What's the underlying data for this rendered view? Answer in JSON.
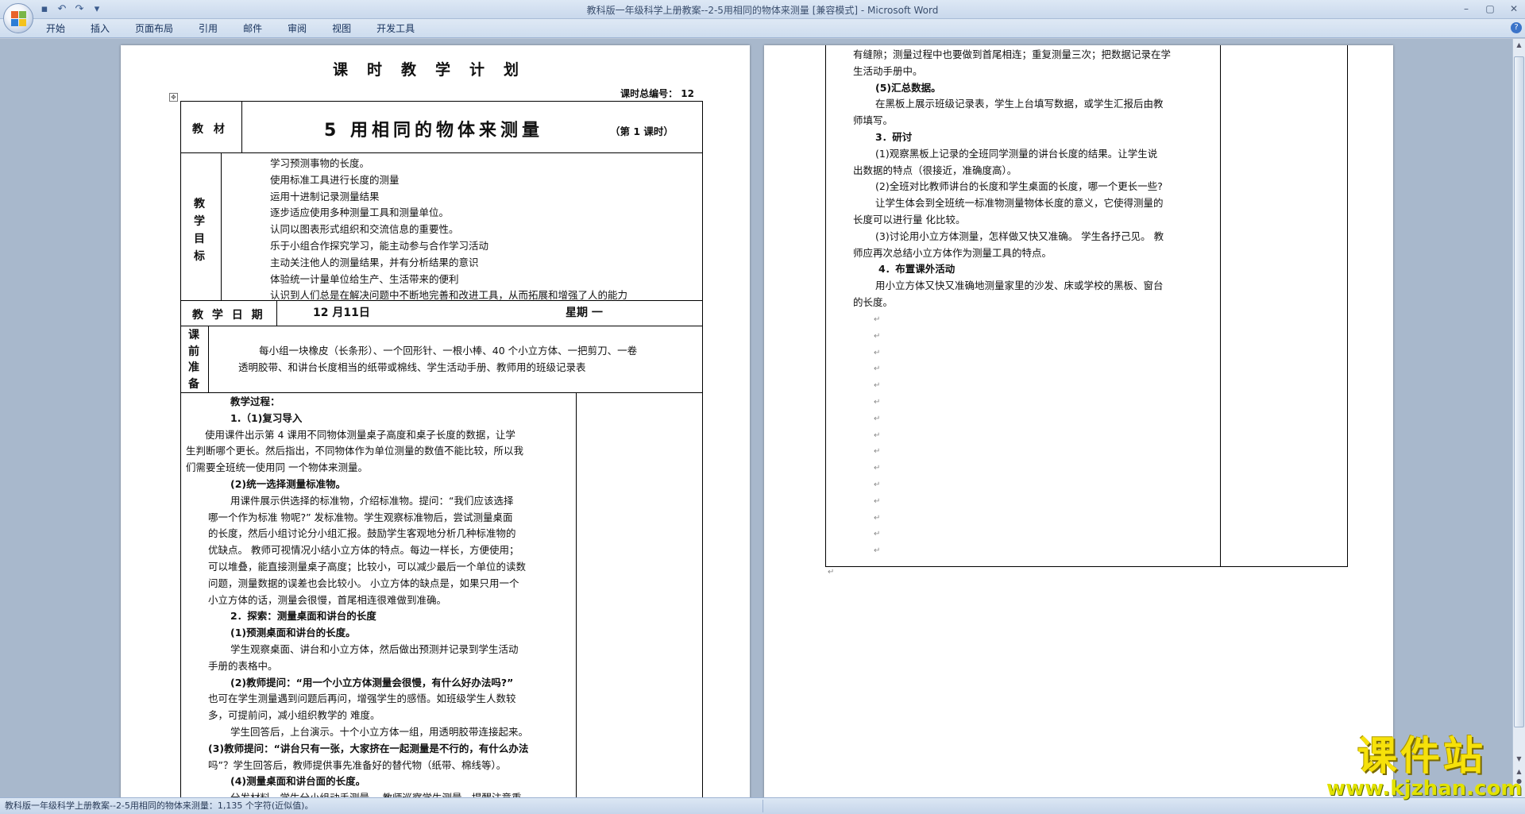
{
  "window": {
    "title": "教科版一年级科学上册教案--2-5用相同的物体来测量 [兼容模式] - Microsoft Word",
    "controls": [
      "–",
      "▢",
      "✕"
    ]
  },
  "quick_access": [
    "save-icon",
    "undo-icon",
    "redo-icon",
    "customize-icon"
  ],
  "ribbon": {
    "tabs": [
      "开始",
      "插入",
      "页面布局",
      "引用",
      "邮件",
      "审阅",
      "视图",
      "开发工具"
    ]
  },
  "page1": {
    "title": "课时教学计划",
    "seq_label": "课时总编号：",
    "seq_value": "12",
    "material_label": "教  材",
    "lesson_title": "5 用相同的物体来测量",
    "lesson_period": "（第 1 课时）",
    "goals_label": [
      "教",
      "学",
      "目",
      "标"
    ],
    "goals": [
      "学习预测事物的长度。",
      " 使用标准工具进行长度的测量",
      "运用十进制记录测量结果",
      "逐步适应使用多种测量工具和测量单位。",
      "认同以图表形式组织和交流信息的重要性。",
      "乐于小组合作探究学习，能主动参与合作学习活动",
      "主动关注他人的测量结果，并有分析结果的意识",
      "体验统一计量单位给生产、生活带来的便利",
      "认识到人们总是在解决问题中不断地完善和改进工具，从而拓展和增强了人的能力"
    ],
    "date_label": "教 学 日 期",
    "date_value": "12   月11日",
    "weekday": "星期 一",
    "prep_label": [
      "课",
      "前",
      "准",
      "备"
    ],
    "prep_lines": [
      "每小组一块橡皮（长条形）、一个回形针、一根小棒、40 个小立方体、一把剪刀、一卷",
      "透明胶带、和讲台长度相当的纸带或棉线、学生活动手册、教师用的班级记录表"
    ],
    "process": [
      {
        "text": "教学过程：",
        "bold": true,
        "indent": 62
      },
      {
        "text": "1.（1)复习导入",
        "bold": true,
        "indent": 62
      },
      {
        "text": "使用课件出示第 4 课用不同物体测量桌子高度和桌子长度的数据，让学",
        "bold": false,
        "indent": 30
      },
      {
        "text": "生判断哪个更长。然后指出，不同物体作为单位测量的数值不能比较，所以我",
        "bold": false,
        "indent": 6
      },
      {
        "text": "们需要全班统一使用同 一个物体来测量。",
        "bold": false,
        "indent": 6
      },
      {
        "text": "(2)统一选择测量标准物。",
        "bold": true,
        "indent": 62
      },
      {
        "text": "用课件展示供选择的标准物，介绍标准物。提问：“我们应该选择",
        "bold": false,
        "indent": 62
      },
      {
        "text": "哪一个作为标准  物呢?”  发标准物。学生观察标准物后，尝试测量桌面",
        "bold": false,
        "indent": 34
      },
      {
        "text": "的长度，然后小组讨论分小组汇报。鼓励学生客观地分析几种标准物的",
        "bold": false,
        "indent": 34
      },
      {
        "text": "优缺点。  教师可视情况小结小立方体的特点。每边一样长，方便使用；",
        "bold": false,
        "indent": 34
      },
      {
        "text": "可以堆叠，能直接测量桌子高度；比较小，可以减少最后一个单位的读数",
        "bold": false,
        "indent": 34
      },
      {
        "text": "问题，测量数据的误差也会比较小。  小立方体的缺点是，如果只用一个",
        "bold": false,
        "indent": 34
      },
      {
        "text": "小立方体的话，测量会很慢，首尾相连很难做到准确。",
        "bold": false,
        "indent": 34
      },
      {
        "text": "2．探索：测量桌面和讲台的长度",
        "bold": true,
        "indent": 62
      },
      {
        "text": "(1)预测桌面和讲台的长度。",
        "bold": true,
        "indent": 62
      },
      {
        "text": "学生观察桌面、讲台和小立方体，然后做出预测并记录到学生活动",
        "bold": false,
        "indent": 62
      },
      {
        "text": "手册的表格中。",
        "bold": false,
        "indent": 34
      },
      {
        "text": "(2)教师提问：“用一个小立方体测量会很慢，有什么好办法吗?”",
        "bold": true,
        "indent": 62
      },
      {
        "text": "也可在学生测量遇到问题后再问，增强学生的感悟。如班级学生人数较",
        "bold": false,
        "indent": 34
      },
      {
        "text": "多，可提前问，减小组织教学的  难度。",
        "bold": false,
        "indent": 34
      },
      {
        "text": "学生回答后，上台演示。十个小立方体一组，用透明胶带连接起来。",
        "bold": false,
        "indent": 62
      },
      {
        "text": "(3)教师提问：“讲台只有一张，大家挤在一起测量是不行的，有什么办法",
        "bold": true,
        "indent": 34
      },
      {
        "text": "吗”？学生回答后，教师提供事先准备好的替代物（纸带、棉线等）。",
        "bold": false,
        "indent": 34
      },
      {
        "text": "(4)测量桌面和讲台面的长度。",
        "bold": true,
        "indent": 62
      },
      {
        "text": "分发材料，学生分小组动手测量。  教师巡察学生测量，提醒注意重",
        "bold": false,
        "indent": 62
      }
    ]
  },
  "page2": {
    "lines": [
      {
        "text": "有缝隙；测量过程中也要做到首尾相连；重复测量三次；把数据记录在学",
        "bold": false,
        "indent": 34
      },
      {
        "text": "生活动手册中。",
        "bold": false,
        "indent": 34
      },
      {
        "text": "(5)汇总数据。",
        "bold": true,
        "indent": 62
      },
      {
        "text": "在黑板上展示班级记录表，学生上台填写数据，或学生汇报后由教",
        "bold": false,
        "indent": 62
      },
      {
        "text": "师填写。",
        "bold": false,
        "indent": 34
      },
      {
        "text": "3．研讨",
        "bold": true,
        "indent": 62
      },
      {
        "text": "(1)观察黑板上记录的全班同学测量的讲台长度的结果。让学生说",
        "bold": false,
        "indent": 62
      },
      {
        "text": "出数据的特点（很接近，准确度高）。",
        "bold": false,
        "indent": 34
      },
      {
        "text": "(2)全班对比教师讲台的长度和学生桌面的长度，哪一个更长一些?",
        "bold": false,
        "indent": 62
      },
      {
        "text": "让学生体会到全班统一标准物测量物体长度的意义，它使得测量的",
        "bold": false,
        "indent": 62
      },
      {
        "text": "长度可以进行量  化比较。",
        "bold": false,
        "indent": 34
      },
      {
        "text": "(3)讨论用小立方体测量，怎样做又快又准确。  学生各抒己见。  教",
        "bold": false,
        "indent": 62
      },
      {
        "text": "师应再次总结小立方体作为测量工具的特点。",
        "bold": false,
        "indent": 34
      },
      {
        "text": "4．布置课外活动",
        "bold": true,
        "indent": 66
      },
      {
        "text": "用小立方体又快又准确地测量家里的沙发、床或学校的黑板、窗台",
        "bold": false,
        "indent": 62
      },
      {
        "text": "的长度。",
        "bold": false,
        "indent": 34
      }
    ],
    "empty_marks": 15
  },
  "status": {
    "text": "教科版一年级科学上册教案--2-5用相同的物体来测量：1,135 个字符(近似值)。"
  },
  "watermark": {
    "main": "课件站",
    "url": "www.kjzhan.com"
  }
}
